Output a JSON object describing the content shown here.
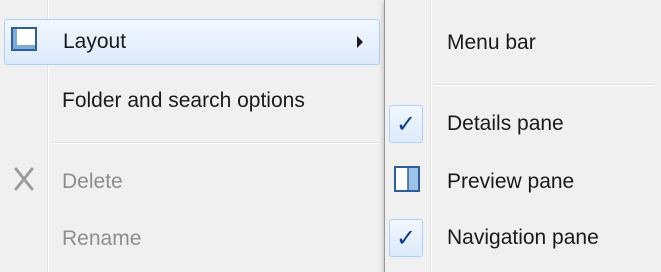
{
  "menu": {
    "items": [
      {
        "label": "Layout",
        "icon": "layout-icon",
        "submenu": true,
        "highlighted": true,
        "enabled": true
      },
      {
        "label": "Folder and search options",
        "enabled": true
      },
      {
        "label": "Delete",
        "icon": "delete-x-icon",
        "enabled": false
      },
      {
        "label": "Rename",
        "enabled": false
      }
    ]
  },
  "submenu": {
    "items": [
      {
        "label": "Menu bar",
        "checked": false
      },
      {
        "label": "Details pane",
        "checked": true,
        "icon": "checkmark-icon"
      },
      {
        "label": "Preview pane",
        "checked": false,
        "icon": "preview-pane-icon"
      },
      {
        "label": "Navigation pane",
        "checked": true,
        "icon": "checkmark-icon"
      }
    ],
    "check_glyph": "✓"
  },
  "colors": {
    "menu_bg": "#f0f0f0",
    "highlight_border": "#aecff7",
    "disabled_text": "#8d8d8d",
    "check_color": "#0b3d91"
  }
}
